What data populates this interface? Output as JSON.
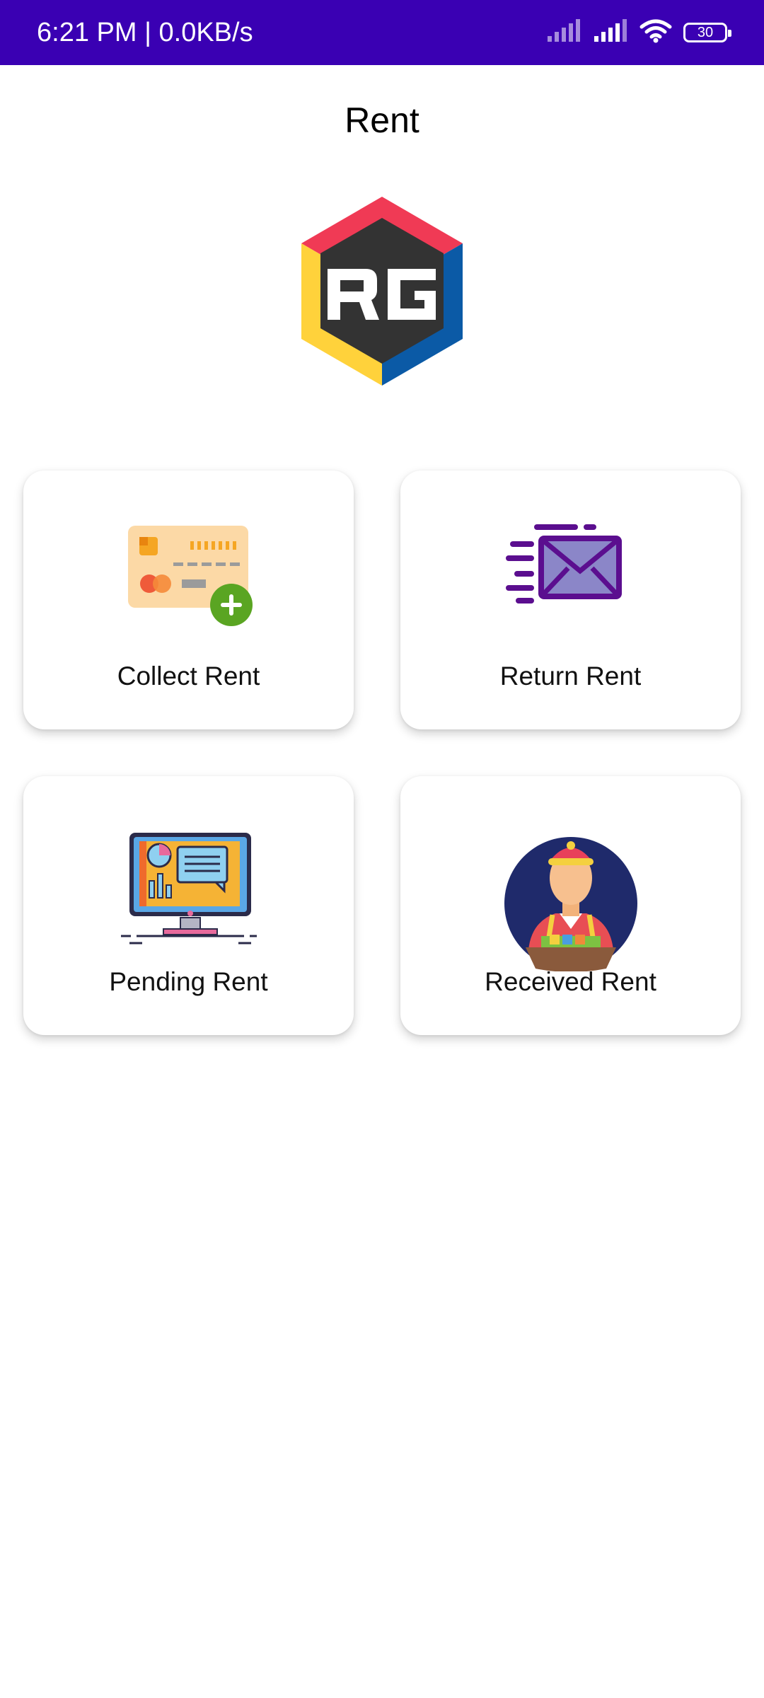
{
  "status_bar": {
    "time_speed": "6:21 PM | 0.0KB/s",
    "battery_level": "30",
    "icons": [
      "signal-icon",
      "signal-icon",
      "wifi-icon",
      "battery-icon"
    ],
    "background": "#3a00b3"
  },
  "header": {
    "title": "Rent"
  },
  "logo": {
    "text": "RG",
    "icon": "rg-logo"
  },
  "cards": [
    {
      "label": "Collect Rent",
      "icon": "credit-card-add-icon"
    },
    {
      "label": "Return Rent",
      "icon": "mail-send-icon"
    },
    {
      "label": "Pending Rent",
      "icon": "monitor-dashboard-icon"
    },
    {
      "label": "Received Rent",
      "icon": "vendor-person-icon"
    }
  ]
}
